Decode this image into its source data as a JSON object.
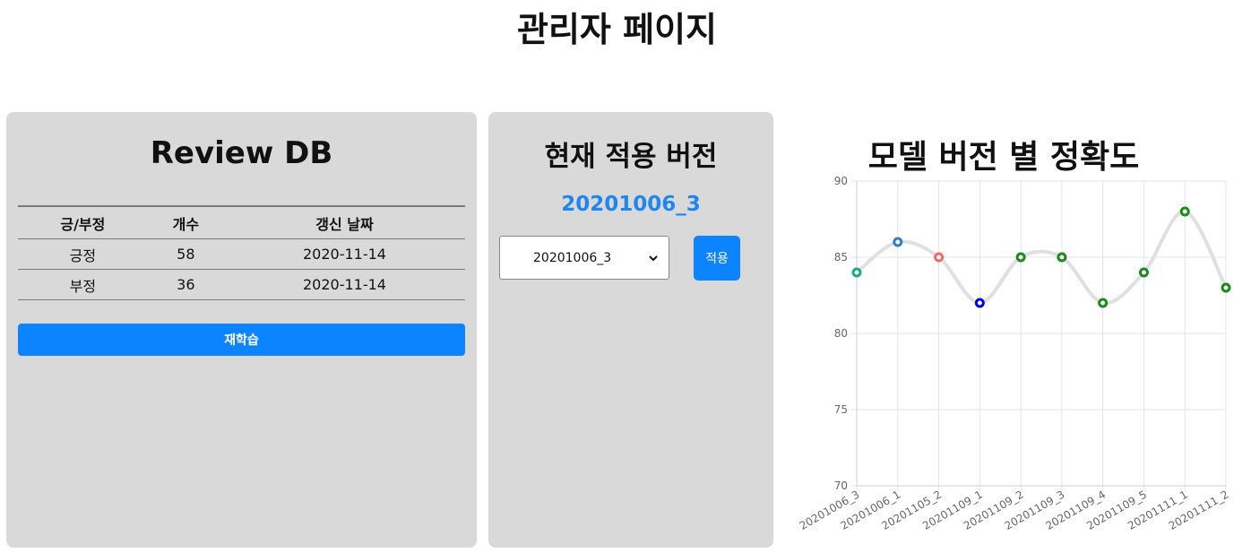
{
  "page": {
    "title": "관리자 페이지"
  },
  "review_db": {
    "title": "Review DB",
    "columns": [
      "긍/부정",
      "개수",
      "갱신 날짜"
    ],
    "rows": [
      {
        "label": "긍정",
        "count": "58",
        "date": "2020-11-14"
      },
      {
        "label": "부정",
        "count": "36",
        "date": "2020-11-14"
      }
    ],
    "retrain_label": "재학습"
  },
  "version": {
    "title": "현재 적용 버전",
    "current": "20201006_3",
    "select_value": "20201006_3",
    "apply_label": "적용"
  },
  "chart": {
    "title": "모델 버전 별 정확도"
  },
  "chart_data": {
    "type": "line",
    "title": "모델 버전 별 정확도",
    "xlabel": "",
    "ylabel": "",
    "categories": [
      "20201006_3",
      "20201006_1",
      "20201105_2",
      "20201109_1",
      "20201109_2",
      "20201109_3",
      "20201109_4",
      "20201109_5",
      "20201111_1",
      "20201111_2"
    ],
    "values": [
      84,
      86,
      85,
      82,
      85,
      85,
      82,
      84,
      88,
      83
    ],
    "point_colors": [
      "#1aaa8a",
      "#2f7fc8",
      "#f26a6a",
      "#0000ee",
      "#1a8a1a",
      "#1a8a1a",
      "#1a8a1a",
      "#1a8a1a",
      "#1a8a1a",
      "#1a8a1a"
    ],
    "line_color": "#e0e0e0",
    "ylim": [
      70,
      90
    ],
    "yticks": [
      70,
      75,
      80,
      85,
      90
    ],
    "grid": true
  }
}
